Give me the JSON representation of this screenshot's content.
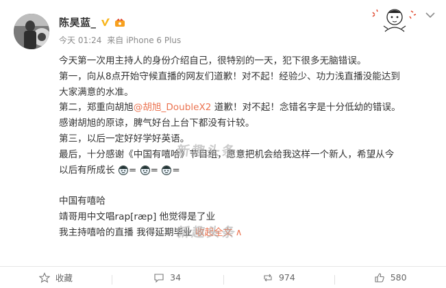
{
  "post": {
    "author": "陈昊蓝_",
    "timestamp": "今天 01:24",
    "source_prefix": "来自",
    "source": "iPhone 6 Plus",
    "lines": {
      "l1": "今天第一次用主持人的身份介绍自己，很特别的一天，犯下很多无脑错误。",
      "l2": "第一，向从8点开始守候直播的网友们道歉！对不起！经验少、功力浅直播没能达到",
      "l3": "大家满意的水准。",
      "l4_pre": "第二，郑重向胡旭",
      "l4_mention": "@胡旭_DoubleX2",
      "l4_post": " 道歉！对不起！念错名字是十分低幼的错误。",
      "l5": "感谢胡旭的原谅，脾气好台上台下都没有计较。",
      "l6": "第三，以后一定好好学好英语。",
      "l7": "最后，十分感谢《中国有嘻哈》节目组，愿意把机会给我这样一个新人，希望从今",
      "l8_pre": "以后有所成长",
      "l8_sep": "=",
      "l9": "中国有嘻哈",
      "l10": "靖哥用中文唱rap[ræp] 他觉得是了业",
      "l11_pre": "我主持嘻哈的直播 我得延期毕业 ",
      "l11_link": "收起全文",
      "l11_arrow": "∧"
    },
    "watermark": "新趣头条"
  },
  "footer": {
    "favorite": "收藏",
    "comments": "34",
    "reposts": "974",
    "likes": "580"
  },
  "colors": {
    "accent": "#eb7350",
    "verified": "#f8b51c"
  },
  "icons": [
    "verified-icon",
    "member-badge-icon",
    "chevron-down-icon",
    "star-icon",
    "comment-icon",
    "repost-icon",
    "like-icon",
    "emoji-icon"
  ]
}
